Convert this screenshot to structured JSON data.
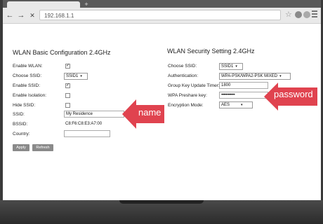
{
  "browser": {
    "new_tab": "+",
    "url": "192.168.1.1",
    "nav_back": "←",
    "nav_forward": "→",
    "nav_close": "✕"
  },
  "basic": {
    "title": "WLAN Basic Configuration 2.4GHz",
    "enable_wlan_label": "Enable WLAN:",
    "enable_wlan_checked": "✓",
    "choose_ssid_label": "Choose SSID:",
    "choose_ssid_value": "SSID1",
    "enable_ssid_label": "Enable SSID:",
    "enable_ssid_checked": "✓",
    "enable_isolation_label": "Enable Isolation:",
    "hide_ssid_label": "Hide SSID:",
    "ssid_label": "SSID:",
    "ssid_value": "My Residence",
    "bssid_label": "BSSID:",
    "bssid_value": "C8:F6:C8:E3:A7:00",
    "country_label": "Country:",
    "country_value": "",
    "apply_label": "Apply",
    "refresh_label": "Refresh"
  },
  "security": {
    "title": "WLAN Security Setting 2.4GHz",
    "choose_ssid_label": "Choose SSID:",
    "choose_ssid_value": "SSID1",
    "auth_label": "Authentication:",
    "auth_value": "WPA-PSK/WPA2-PSK MIXED",
    "group_key_label": "Group Key Update Timer:",
    "group_key_value": "1800",
    "preshare_label": "WPA Preshare key:",
    "preshare_value": "••••••••••••",
    "encryption_label": "Encryption Mode:",
    "encryption_value": "AES"
  },
  "callouts": {
    "name": "name",
    "password": "password",
    "color": "#e0434f"
  },
  "icons": {
    "dropdown": "▾"
  }
}
